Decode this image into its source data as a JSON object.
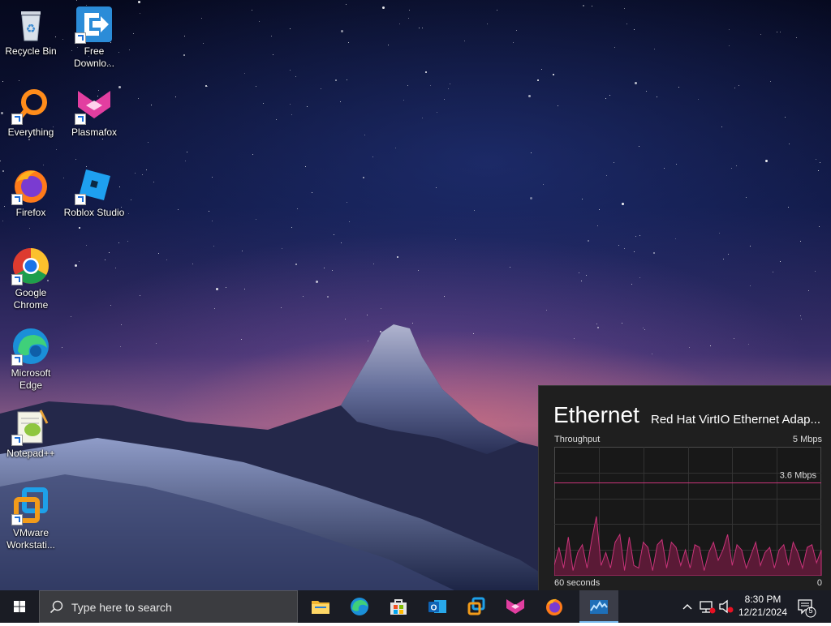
{
  "desktop": {
    "icons": [
      {
        "id": "recycle-bin",
        "label": "Recycle Bin"
      },
      {
        "id": "free-download",
        "label": "Free Downlo..."
      },
      {
        "id": "everything",
        "label": "Everything"
      },
      {
        "id": "plasmafox",
        "label": "Plasmafox"
      },
      {
        "id": "firefox",
        "label": "Firefox"
      },
      {
        "id": "roblox-studio",
        "label": "Roblox Studio"
      },
      {
        "id": "google-chrome",
        "label": "Google Chrome"
      },
      {
        "id": "microsoft-edge",
        "label": "Microsoft Edge"
      },
      {
        "id": "notepad-plus-plus",
        "label": "Notepad++"
      },
      {
        "id": "vmware-workstation",
        "label": "VMware Workstati..."
      }
    ]
  },
  "widget": {
    "title": "Ethernet",
    "adapter": "Red Hat VirtIO Ethernet Adap...",
    "throughput_label": "Throughput",
    "max_label": "5 Mbps",
    "line_label": "3.6 Mbps",
    "time_label": "60 seconds",
    "zero_label": "0",
    "line_value": 3.6,
    "max_value": 5,
    "accent": "#c9347a",
    "series": [
      0.4,
      1.1,
      0.3,
      1.5,
      0.2,
      0.9,
      1.2,
      0.3,
      1.4,
      2.3,
      0.4,
      0.9,
      0.3,
      1.3,
      1.6,
      0.2,
      1.5,
      0.4,
      0.3,
      1.3,
      1.1,
      0.2,
      1.2,
      1.4,
      0.3,
      1.3,
      1.1,
      0.4,
      1.0,
      0.3,
      1.2,
      1.1,
      0.2,
      0.9,
      1.3,
      0.6,
      1.0,
      1.6,
      0.4,
      1.2,
      1.0,
      0.3,
      0.8,
      1.3,
      0.4,
      0.9,
      1.1,
      0.3,
      1.0,
      1.2,
      0.4,
      1.3,
      0.9,
      0.3,
      1.1,
      1.2,
      0.5,
      1.0
    ]
  },
  "taskbar": {
    "search_placeholder": "Type here to search",
    "apps": [
      "file-explorer",
      "edge",
      "microsoft-store",
      "outlook",
      "vmware",
      "plasmafox",
      "firefox",
      "task-manager"
    ],
    "active_app": "task-manager",
    "clock_time": "8:30 PM",
    "clock_date": "12/21/2024",
    "notification_count": "5",
    "accent": "#76b9ed"
  }
}
